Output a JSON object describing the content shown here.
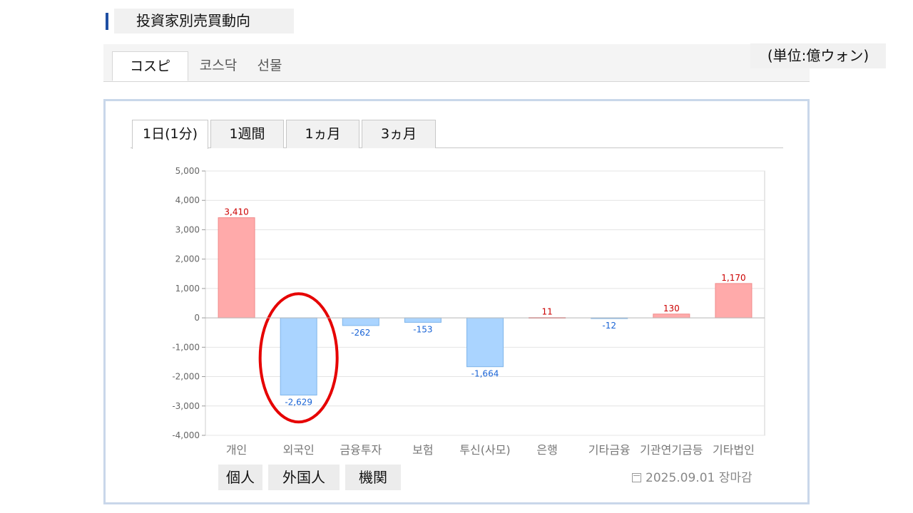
{
  "section": {
    "title": "投資家別売買動向"
  },
  "unit_label": "(単位:億ウォン)",
  "market_tabs": [
    {
      "label": "コスピ",
      "active": true
    },
    {
      "label": "코스닥",
      "active": false
    },
    {
      "label": "선물",
      "active": false
    }
  ],
  "period_tabs": [
    {
      "label": "1日(1分)",
      "active": true
    },
    {
      "label": "1週間",
      "active": false
    },
    {
      "label": "1ヵ月",
      "active": false
    },
    {
      "label": "3ヵ月",
      "active": false
    }
  ],
  "investor_labels": [
    "個人",
    "外国人",
    "機関"
  ],
  "date_stamp": "2025.09.01 장마감",
  "colors": {
    "positive_fill": "#ffaaaa",
    "positive_stroke": "#f08c8c",
    "negative_fill": "#aad4ff",
    "negative_stroke": "#7fb5ea",
    "positive_label": "#cc0000",
    "negative_label": "#1a64d6",
    "highlight": "#e60000"
  },
  "chart_data": {
    "type": "bar",
    "categories": [
      "개인",
      "외국인",
      "금융투자",
      "보험",
      "투신(사모)",
      "은행",
      "기타금융",
      "기관연기금등",
      "기타법인"
    ],
    "values": [
      3410,
      -2629,
      -262,
      -153,
      -1664,
      11,
      -12,
      130,
      1170
    ],
    "data_labels": [
      "3,410",
      "-2,629",
      "-262",
      "-153",
      "-1,664",
      "11",
      "-12",
      "130",
      "1,170"
    ],
    "yticks": [
      5000,
      4000,
      3000,
      2000,
      1000,
      0,
      -1000,
      -2000,
      -3000,
      -4000
    ],
    "ytick_labels": [
      "5,000",
      "4,000",
      "3,000",
      "2,000",
      "1,000",
      "0",
      "-1,000",
      "-2,000",
      "-3,000",
      "-4,000"
    ],
    "ylim": [
      -4000,
      5000
    ],
    "grid": true,
    "highlighted_category": "외국인"
  }
}
